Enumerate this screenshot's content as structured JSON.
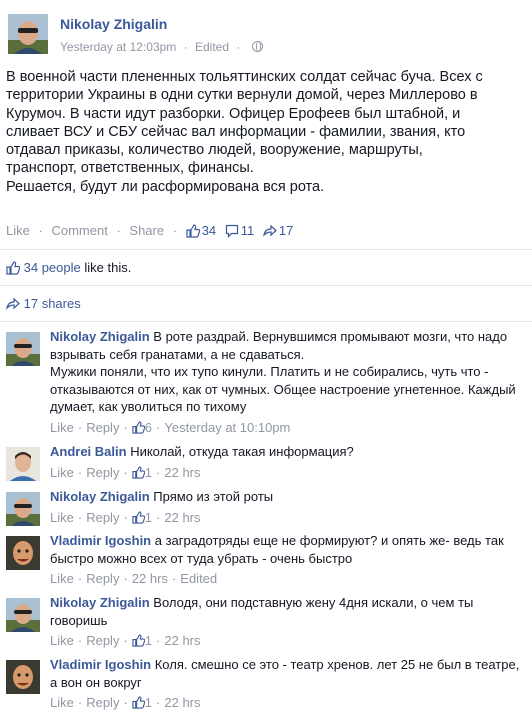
{
  "post": {
    "author": "Nikolay Zhigalin",
    "time": "Yesterday at 12:03pm",
    "edited": "Edited",
    "separator": "·",
    "text_lines": [
      "В военной части плененных тольяттинских солдат сейчас буча. Всех с",
      "территории Украины в одни сутки вернули домой, через Миллерово в",
      "Курумоч. В части идут разборки. Офицер Ерофеев был штабной, и",
      "сливает ВСУ и СБУ сейчас вал информации - фамилии, звания, кто",
      "отдавал приказы, количество людей, вооружение, маршруты,",
      "транспорт, ответственных, финансы.",
      "Решается, будут ли расформирована вся рота."
    ],
    "actions": {
      "like": "Like",
      "comment": "Comment",
      "share": "Share",
      "like_count": "34",
      "comment_count": "11",
      "share_count": "17"
    },
    "likes_summary": {
      "people": "34 people",
      "suffix": " like this."
    },
    "shares_summary": "17 shares"
  },
  "colors": {
    "link": "#3b5998",
    "meta": "#9197a3",
    "text": "#141823",
    "divider": "#e5e5e5"
  },
  "icons": [
    "globe-icon",
    "like-thumb-icon",
    "comment-bubble-icon",
    "share-arrow-icon"
  ],
  "comments": [
    {
      "author": "Nikolay Zhigalin",
      "text": " В роте раздрай. Вернувшимся промывают мозги, что надо взрывать себя гранатами, а не сдаваться.",
      "text2": "Мужики поняли, что их тупо кинули. Платить и не собирались, чуть что - отказываются от них, как от чумных. Общее настроение угнетенное. Каждый думает, как уволиться по тихому",
      "like": "Like",
      "reply": "Reply",
      "likes": "6",
      "time": "Yesterday at 10:10pm",
      "edited": ""
    },
    {
      "author": "Andrei Balin",
      "text": " Николай, откуда такая информация?",
      "like": "Like",
      "reply": "Reply",
      "likes": "1",
      "time": "22 hrs",
      "edited": ""
    },
    {
      "author": "Nikolay Zhigalin",
      "text": " Прямо из этой роты",
      "like": "Like",
      "reply": "Reply",
      "likes": "1",
      "time": "22 hrs",
      "edited": ""
    },
    {
      "author": "Vladimir Igoshin",
      "text": " а заградотряды еще не формируют? и опять же- ведь так быстро можно всех от туда убрать - очень быстро",
      "like": "Like",
      "reply": "Reply",
      "likes": "",
      "time": "22 hrs",
      "edited": "Edited"
    },
    {
      "author": "Nikolay Zhigalin",
      "text": " Володя, они подставную жену 4дня искали, о чем ты говоришь",
      "like": "Like",
      "reply": "Reply",
      "likes": "1",
      "time": "22 hrs",
      "edited": ""
    },
    {
      "author": "Vladimir Igoshin",
      "text": " Коля. смешно се это - театр хренов. лет 25 не был в театре, а вон он вокруг",
      "like": "Like",
      "reply": "Reply",
      "likes": "1",
      "time": "22 hrs",
      "edited": ""
    }
  ]
}
